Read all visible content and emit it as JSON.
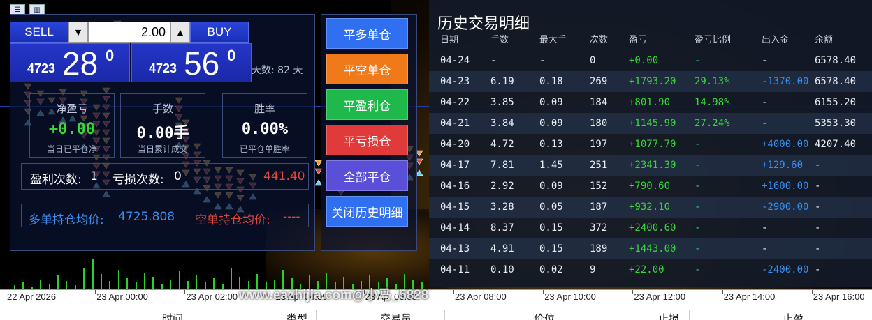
{
  "toolbar": {
    "icons": [
      "list-icon",
      "chart-icon"
    ]
  },
  "trade": {
    "sell_label": "SELL",
    "buy_label": "BUY",
    "lot_value": "2.00",
    "bid": {
      "small": "4723",
      "big": "28",
      "sup": "0"
    },
    "ask": {
      "small": "4723",
      "big": "56",
      "sup": "0"
    },
    "days_label": "天数: 82 天",
    "stats": [
      {
        "title": "净盈亏",
        "value": "+0.00",
        "sub": "当日已平仓净",
        "color": "#39d639"
      },
      {
        "title": "手数",
        "value": "0.00手",
        "sub": "当日累计成交",
        "color": "#ffffff"
      },
      {
        "title": "胜率",
        "value": "0.00%",
        "sub": "已平仓单胜率",
        "color": "#ffffff"
      }
    ],
    "win_count_label": "盈利次数:",
    "win_count": "1",
    "loss_count_label": "亏损次数:",
    "loss_count": "0",
    "pl_value": "441.40",
    "long_avg_label": "多单持仓均价:",
    "long_avg": "4725.808",
    "short_avg_label": "空单持仓均价:",
    "short_avg": "----"
  },
  "controls": [
    {
      "label": "平多单仓",
      "color": "#2f6ff0"
    },
    {
      "label": "平空单仓",
      "color": "#f07a1a"
    },
    {
      "label": "平盈利仓",
      "color": "#1fb84a"
    },
    {
      "label": "平亏损仓",
      "color": "#e03a3a"
    },
    {
      "label": "全部平仓",
      "color": "#5a4fd8"
    },
    {
      "label": "关闭历史明细",
      "color": "#2f6ff0"
    }
  ],
  "history": {
    "title": "历史交易明细",
    "columns": [
      "日期",
      "手数",
      "最大手",
      "次数",
      "盈亏",
      "盈亏比例",
      "出入金",
      "余额"
    ],
    "rows": [
      [
        "04-24",
        "-",
        "-",
        "0",
        "+0.00",
        "-",
        "-",
        "6578.40"
      ],
      [
        "04-23",
        "6.19",
        "0.18",
        "269",
        "+1793.20",
        "29.13%",
        "-1370.00",
        "6578.40"
      ],
      [
        "04-22",
        "3.85",
        "0.09",
        "184",
        "+801.90",
        "14.98%",
        "-",
        "6155.20"
      ],
      [
        "04-21",
        "3.84",
        "0.09",
        "180",
        "+1145.90",
        "27.24%",
        "-",
        "5353.30"
      ],
      [
        "04-20",
        "4.72",
        "0.13",
        "197",
        "+1077.70",
        "-",
        "+4000.00",
        "4207.40"
      ],
      [
        "04-17",
        "7.81",
        "1.45",
        "251",
        "+2341.30",
        "-",
        "+129.60",
        "-"
      ],
      [
        "04-16",
        "2.92",
        "0.09",
        "152",
        "+790.60",
        "-",
        "+1600.00",
        "-"
      ],
      [
        "04-15",
        "3.28",
        "0.05",
        "187",
        "+932.10",
        "-",
        "-2900.00",
        "-"
      ],
      [
        "04-14",
        "8.37",
        "0.15",
        "372",
        "+2400.60",
        "-",
        "-",
        "-"
      ],
      [
        "04-13",
        "4.91",
        "0.15",
        "189",
        "+1443.00",
        "-",
        "-",
        "-"
      ],
      [
        "04-11",
        "0.10",
        "0.02",
        "9",
        "+22.00",
        "-",
        "-2400.00",
        "-"
      ]
    ]
  },
  "time_axis": [
    "22 Apr 2026",
    "23 Apr 00:00",
    "23 Apr 02:00",
    "23 Apr 04:00",
    "23 Apr 06:00",
    "23 Apr 08:00",
    "23 Apr 10:00",
    "23 Apr 12:00",
    "23 Apr 14:00",
    "23 Apr 16:00"
  ],
  "bottom_header": [
    "时间",
    "类型",
    "交易量",
    "价位",
    "止损",
    "止盈"
  ],
  "watermark": "www.eazhijia.com@小马_5828",
  "colors": {
    "green": "#39d639",
    "teal": "#2bc0a0",
    "blue": "#3a8ef0",
    "red": "#e0463a",
    "orange": "#f07a1a"
  }
}
